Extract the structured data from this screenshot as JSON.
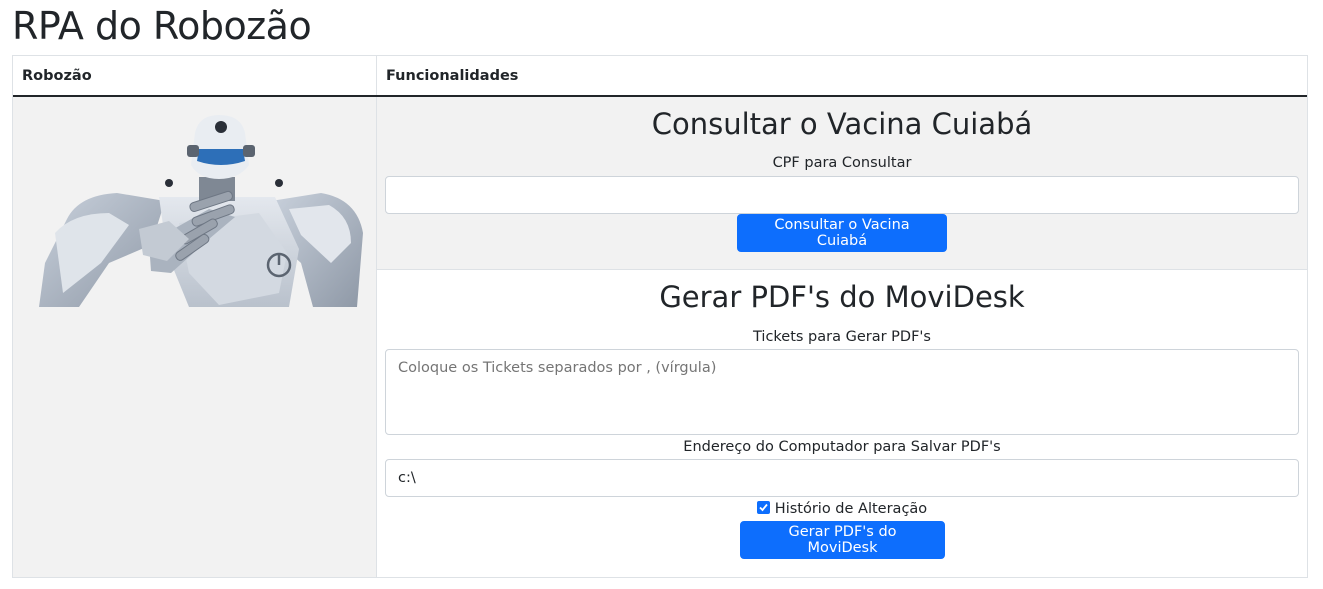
{
  "page": {
    "title": "RPA do Robozão"
  },
  "table": {
    "col_robozao": "Robozão",
    "col_funcionalidades": "Funcionalidades"
  },
  "vacina": {
    "title": "Consultar o Vacina Cuiabá",
    "cpf_label": "CPF para Consultar",
    "cpf_value": "",
    "button_label": "Consultar o Vacina Cuiabá"
  },
  "movidesk": {
    "title": "Gerar PDF's do MoviDesk",
    "tickets_label": "Tickets para Gerar PDF's",
    "tickets_placeholder": "Coloque os Tickets separados por , (vírgula)",
    "path_label": "Endereço do Computador para Salvar PDF's",
    "path_value": "c:\\",
    "history_label": "Histório de Alteração",
    "history_checked": true,
    "button_label": "Gerar PDF's do MoviDesk"
  },
  "colors": {
    "primary": "#0d6efd",
    "stripe": "#f2f2f2"
  }
}
